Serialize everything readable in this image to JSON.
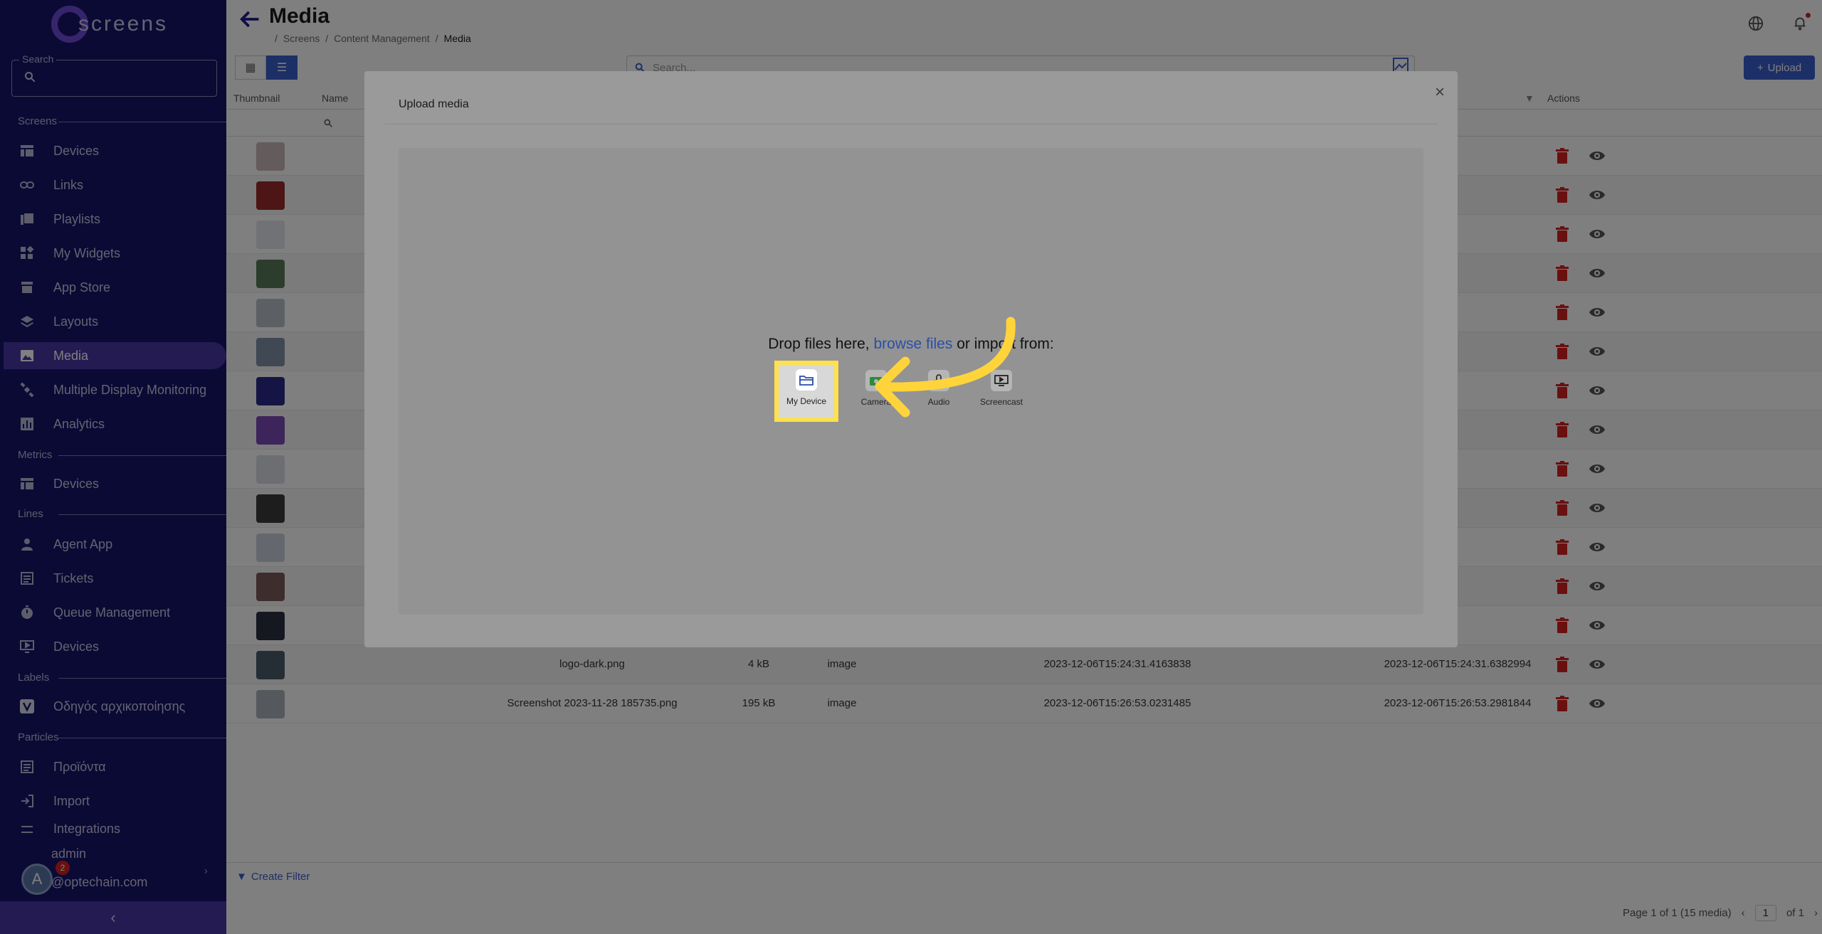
{
  "app": {
    "logo_text": "screens"
  },
  "sidebar": {
    "search_legend": "Search",
    "sections": {
      "screens": "Screens",
      "metrics": "Metrics",
      "lines": "Lines",
      "labels": "Labels",
      "particles": "Particles"
    },
    "items": {
      "devices": "Devices",
      "links": "Links",
      "playlists": "Playlists",
      "my_widgets": "My Widgets",
      "app_store": "App Store",
      "layouts": "Layouts",
      "media": "Media",
      "mdm": "Multiple Display Monitoring",
      "analytics": "Analytics",
      "metrics_devices": "Devices",
      "agent_app": "Agent App",
      "tickets": "Tickets",
      "queue": "Queue Management",
      "lines_devices": "Devices",
      "label_guide": "Οδηγός αρχικοποίησης",
      "products": "Προϊόντα",
      "import": "Import",
      "integrations": "Integrations"
    },
    "user": {
      "name": "admin",
      "email": "@optechain.com",
      "badge": "2",
      "avatar_letter": "A"
    }
  },
  "header": {
    "title": "Media",
    "breadcrumb": [
      "Screens",
      "Content Management",
      "Media"
    ],
    "search_placeholder": "Search...",
    "upload_label": "Upload"
  },
  "table": {
    "columns": [
      "Thumbnail",
      "Name",
      "Actions"
    ],
    "rows": [
      {
        "name": "",
        "size": "",
        "type": "",
        "created": "",
        "updated": ""
      },
      {
        "name": "",
        "size": "",
        "type": "",
        "created": "",
        "updated": ""
      },
      {
        "name": "",
        "size": "",
        "type": "",
        "created": "",
        "updated": ""
      },
      {
        "name": "",
        "size": "",
        "type": "",
        "created": "",
        "updated": ""
      },
      {
        "name": "",
        "size": "",
        "type": "",
        "created": "",
        "updated": ""
      },
      {
        "name": "",
        "size": "",
        "type": "",
        "created": "",
        "updated": ""
      },
      {
        "name": "",
        "size": "",
        "type": "",
        "created": "",
        "updated": ""
      },
      {
        "name": "",
        "size": "",
        "type": "",
        "created": "",
        "updated": ""
      },
      {
        "name": "",
        "size": "",
        "type": "",
        "created": "",
        "updated": ""
      },
      {
        "name": "",
        "size": "",
        "type": "",
        "created": "",
        "updated": ""
      },
      {
        "name": "",
        "size": "",
        "type": "",
        "created": "",
        "updated": ""
      },
      {
        "name": "",
        "size": "",
        "type": "",
        "created": "",
        "updated": ""
      },
      {
        "name": "",
        "size": "",
        "type": "",
        "created": "",
        "updated": ""
      },
      {
        "name": "logo-dark.png",
        "size": "4 kB",
        "type": "image",
        "created": "2023-12-06T15:24:31.4163838",
        "updated": "2023-12-06T15:24:31.6382994"
      },
      {
        "name": "Screenshot 2023-11-28 185735.png",
        "size": "195 kB",
        "type": "image",
        "created": "2023-12-06T15:26:53.0231485",
        "updated": "2023-12-06T15:26:53.2981844"
      }
    ],
    "create_filter": "Create Filter",
    "pager_summary": "Page 1 of 1 (15 media)",
    "pager_current": "1",
    "pager_of": "of 1"
  },
  "modal": {
    "title": "Upload media",
    "drop_prefix": "Drop files here,",
    "drop_link": "browse files",
    "drop_suffix": "or import from:",
    "sources": [
      "My Device",
      "Camera",
      "Audio",
      "Screencast"
    ]
  },
  "colors": {
    "sidebar_bg": "#16146a",
    "accent": "#4a36a6",
    "primary": "#3a5fcf",
    "highlight": "#ffe14d",
    "danger": "#d42020"
  }
}
